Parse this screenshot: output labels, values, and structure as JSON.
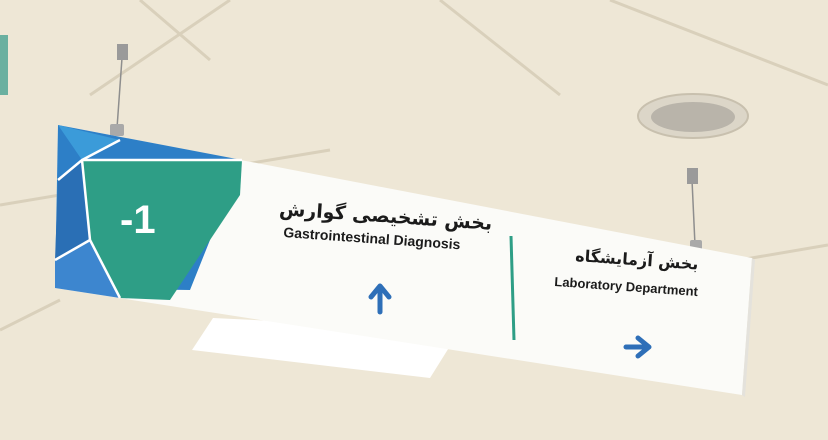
{
  "floor_number": "-1",
  "sign": {
    "left_fa": "بخش تشخیصی گوارش",
    "left_en": "Gastrointestinal Diagnosis",
    "right_fa": "بخش آزمایشگاه",
    "right_en": "Laboratory Department"
  },
  "colors": {
    "ceiling": "#eee7d6",
    "sign_panel": "#fbfbf8",
    "teal": "#2e9e86",
    "blue": "#2d7fc7",
    "arrow": "#2e6fb8"
  }
}
